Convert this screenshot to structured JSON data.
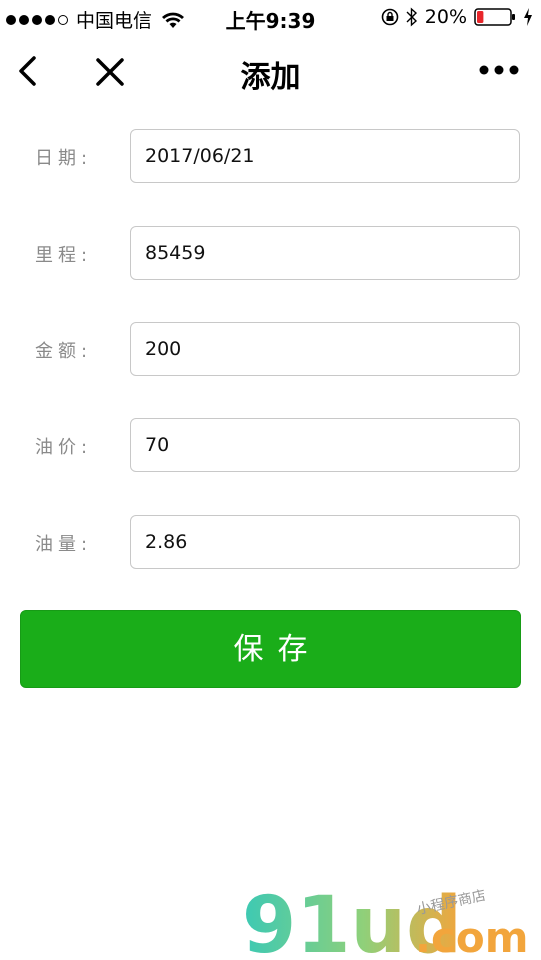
{
  "status_bar": {
    "carrier": "中国电信",
    "time": "上午9:39",
    "battery_percent": "20%",
    "battery_level": 0.2,
    "battery_color": "#e8262b"
  },
  "nav": {
    "title": "添加",
    "back_icon": "chevron-left-icon",
    "close_icon": "close-icon",
    "more_icon": "more-dots-icon"
  },
  "form": {
    "fields": [
      {
        "label": "日期:",
        "value": "2017/06/21"
      },
      {
        "label": "里程:",
        "value": "85459"
      },
      {
        "label": "金额:",
        "value": "200"
      },
      {
        "label": "油价:",
        "value": "70"
      },
      {
        "label": "油量:",
        "value": "2.86"
      }
    ]
  },
  "save_button": {
    "label": "保存",
    "color": "#1aad19"
  },
  "watermark": {
    "logo_text": "91ud.com",
    "tagline": "小程序商店"
  }
}
